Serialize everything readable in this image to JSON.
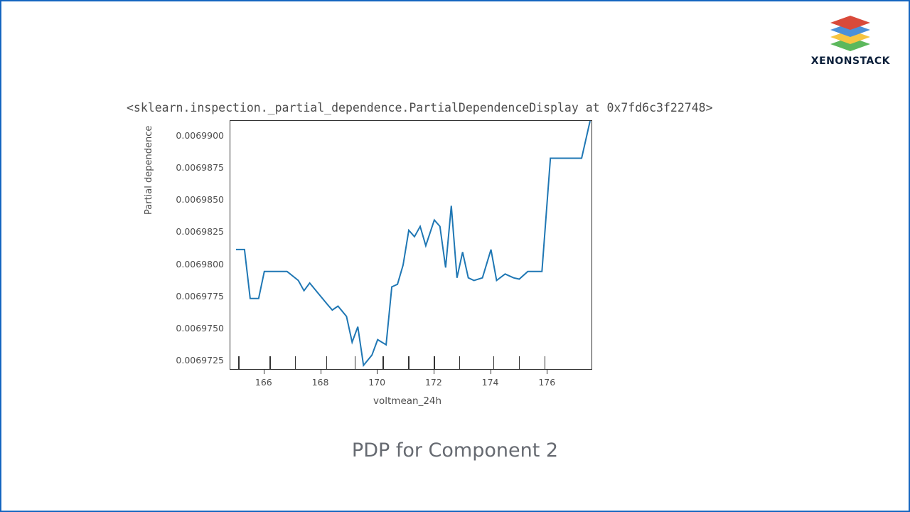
{
  "logo_text": "XENONSTACK",
  "repr": "<sklearn.inspection._partial_dependence.PartialDependenceDisplay at 0x7fd6c3f22748>",
  "caption": "PDP for Component 2",
  "chart_data": {
    "type": "line",
    "title": "",
    "xlabel": "voltmean_24h",
    "ylabel": "Partial dependence",
    "xlim": [
      164.8,
      177.6
    ],
    "ylim": [
      0.0069718,
      0.0069912
    ],
    "xticks": [
      166,
      168,
      170,
      172,
      174,
      176
    ],
    "yticks": [
      0.0069725,
      0.006975,
      0.0069775,
      0.00698,
      0.0069825,
      0.006985,
      0.0069875,
      0.00699
    ],
    "ytick_labels": [
      "0.0069725",
      "0.0069750",
      "0.0069775",
      "0.0069800",
      "0.0069825",
      "0.0069850",
      "0.0069875",
      "0.0069900"
    ],
    "rug_ticks": [
      165.1,
      166.2,
      167.1,
      168.2,
      169.2,
      170.2,
      171.1,
      172.0,
      172.9,
      174.1,
      175.0,
      175.9
    ],
    "series": [
      {
        "name": "partial_dependence",
        "color": "#1f77b4",
        "x": [
          165.0,
          165.3,
          165.5,
          165.8,
          166.0,
          166.3,
          166.8,
          167.2,
          167.4,
          167.6,
          167.9,
          168.2,
          168.4,
          168.6,
          168.9,
          169.1,
          169.3,
          169.5,
          169.8,
          170.0,
          170.3,
          170.5,
          170.7,
          170.9,
          171.1,
          171.3,
          171.5,
          171.7,
          172.0,
          172.2,
          172.4,
          172.6,
          172.8,
          173.0,
          173.2,
          173.4,
          173.7,
          174.0,
          174.2,
          174.5,
          174.8,
          175.0,
          175.3,
          175.6,
          175.8,
          176.1,
          176.8,
          177.2,
          177.5
        ],
        "y": [
          0.0069812,
          0.0069812,
          0.0069774,
          0.0069774,
          0.0069795,
          0.0069795,
          0.0069795,
          0.0069788,
          0.006978,
          0.0069786,
          0.0069778,
          0.006977,
          0.0069765,
          0.0069768,
          0.006976,
          0.006974,
          0.0069752,
          0.0069722,
          0.006973,
          0.0069742,
          0.0069738,
          0.0069783,
          0.0069785,
          0.00698,
          0.0069827,
          0.0069822,
          0.006983,
          0.0069815,
          0.0069835,
          0.006983,
          0.0069798,
          0.0069846,
          0.006979,
          0.006981,
          0.006979,
          0.0069788,
          0.006979,
          0.0069812,
          0.0069788,
          0.0069793,
          0.006979,
          0.0069789,
          0.0069795,
          0.0069795,
          0.0069795,
          0.0069883,
          0.0069883,
          0.0069883,
          0.0069912
        ]
      }
    ]
  }
}
